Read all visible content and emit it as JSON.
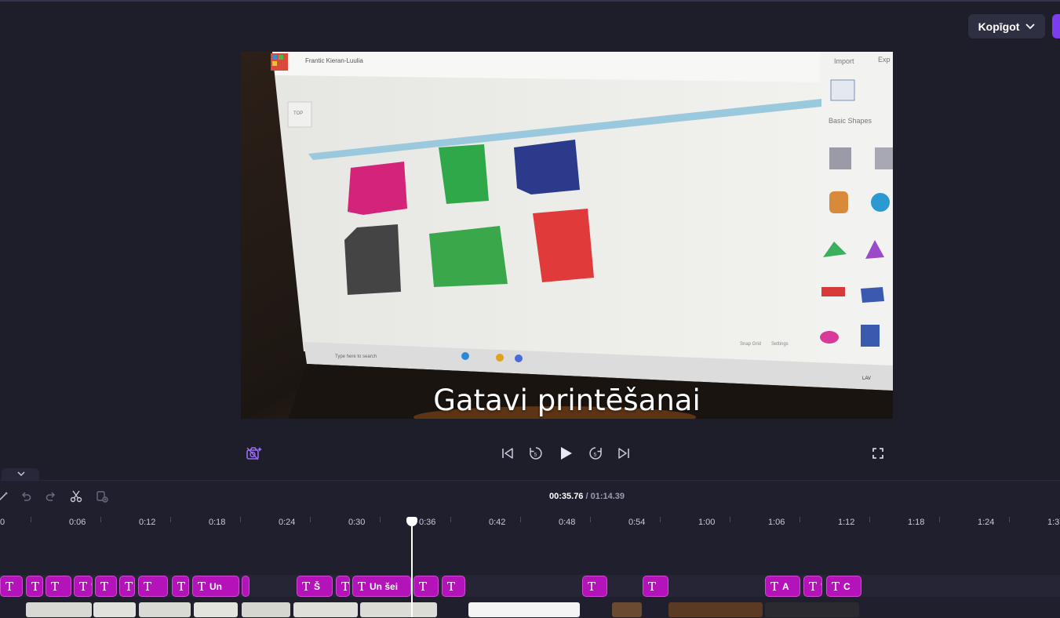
{
  "header": {
    "export_label": "Kopīgot"
  },
  "preview": {
    "caption": "Gatavi printēšanai",
    "screen": {
      "window_title": "Frantic Kieran-Luulia",
      "import_label": "Import",
      "export_label": "Exp",
      "basic_shapes_label": "Basic Shapes",
      "top_label": "TOP",
      "taskbar_search": "Type here to search",
      "tray_lang": "LAV",
      "settings_label": "Settings",
      "snap_label": "Snap Grid"
    }
  },
  "timeline": {
    "current_time": "00:35.76",
    "duration": " / 01:14.39",
    "ticks": [
      "0",
      "0:06",
      "0:12",
      "0:18",
      "0:24",
      "0:30",
      "0:36",
      "0:42",
      "0:48",
      "0:54",
      "1:00",
      "1:06",
      "1:12",
      "1:18",
      "1:24",
      "1:3"
    ],
    "text_clips": [
      {
        "label": ""
      },
      {
        "label": "'"
      },
      {
        "label": ""
      },
      {
        "label": "'"
      },
      {
        "label": ""
      },
      {
        "label": ""
      },
      {
        "label": ""
      },
      {
        "label": "'"
      },
      {
        "label": "Un"
      },
      {
        "label": ""
      },
      {
        "label": "Š"
      },
      {
        "label": ""
      },
      {
        "label": "Un šei"
      },
      {
        "label": ""
      },
      {
        "label": ""
      },
      {
        "label": ""
      },
      {
        "label": ""
      },
      {
        "label": "A"
      },
      {
        "label": "'"
      },
      {
        "label": "C"
      }
    ]
  },
  "icons": {
    "export": "chevron-down-icon",
    "camera": "camera-off-sparkle-icon",
    "skip_back": "skip-back-icon",
    "rewind": "rewind-5-icon",
    "play": "play-icon",
    "forward": "forward-5-icon",
    "skip_forward": "skip-forward-icon",
    "fullscreen": "fullscreen-icon",
    "collapse": "chevron-down-icon",
    "magic": "magic-wand-icon",
    "undo": "undo-icon",
    "redo": "redo-icon",
    "split": "scissors-icon",
    "duplicate": "duplicate-icon"
  },
  "colors": {
    "accent": "#7b3cf2",
    "text_clip": "#b313b8",
    "background": "#1e1e2a"
  }
}
